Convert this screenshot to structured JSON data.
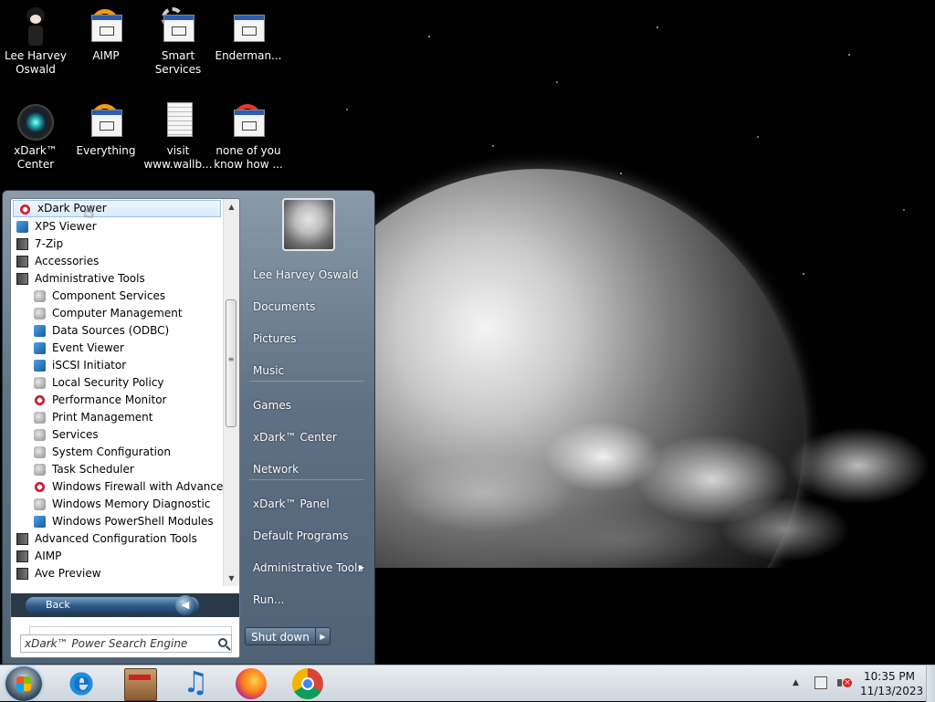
{
  "desktop_icons": [
    {
      "label": "Lee Harvey Oswald",
      "icon": "user-doll-icon"
    },
    {
      "label": "AIMP",
      "icon": "aimp-icon"
    },
    {
      "label": "Smart Services",
      "icon": "gear-icon"
    },
    {
      "label": "Enderman...",
      "icon": "app-window-icon"
    },
    {
      "label": "xDark™ Center",
      "icon": "xdark-orb-icon"
    },
    {
      "label": "Everything",
      "icon": "everything-icon"
    },
    {
      "label": "visit www.wallb...",
      "icon": "document-icon"
    },
    {
      "label": "none of you know how ...",
      "icon": "red-ring-icon"
    }
  ],
  "start_menu": {
    "programs": [
      {
        "label": "xDark Power",
        "level": 0,
        "icon": "xdark-power-icon",
        "highlighted": true
      },
      {
        "label": "XPS Viewer",
        "level": 0,
        "icon": "xps-viewer-icon"
      },
      {
        "label": "7-Zip",
        "level": 0,
        "icon": "folder-icon"
      },
      {
        "label": "Accessories",
        "level": 0,
        "icon": "folder-icon"
      },
      {
        "label": "Administrative Tools",
        "level": 0,
        "icon": "folder-icon"
      },
      {
        "label": "Component Services",
        "level": 1,
        "icon": "component-services-icon"
      },
      {
        "label": "Computer Management",
        "level": 1,
        "icon": "computer-management-icon"
      },
      {
        "label": "Data Sources (ODBC)",
        "level": 1,
        "icon": "database-icon"
      },
      {
        "label": "Event Viewer",
        "level": 1,
        "icon": "event-viewer-icon"
      },
      {
        "label": "iSCSI Initiator",
        "level": 1,
        "icon": "globe-icon"
      },
      {
        "label": "Local Security Policy",
        "level": 1,
        "icon": "security-policy-icon"
      },
      {
        "label": "Performance Monitor",
        "level": 1,
        "icon": "performance-monitor-icon"
      },
      {
        "label": "Print Management",
        "level": 1,
        "icon": "printer-icon"
      },
      {
        "label": "Services",
        "level": 1,
        "icon": "services-icon"
      },
      {
        "label": "System Configuration",
        "level": 1,
        "icon": "system-config-icon"
      },
      {
        "label": "Task Scheduler",
        "level": 1,
        "icon": "task-scheduler-icon"
      },
      {
        "label": "Windows Firewall with Advanced Se",
        "level": 1,
        "icon": "firewall-icon"
      },
      {
        "label": "Windows Memory Diagnostic",
        "level": 1,
        "icon": "memory-diagnostic-icon"
      },
      {
        "label": "Windows PowerShell Modules",
        "level": 1,
        "icon": "powershell-icon"
      },
      {
        "label": "Advanced Configuration Tools",
        "level": 0,
        "icon": "folder-icon"
      },
      {
        "label": "AIMP",
        "level": 0,
        "icon": "folder-icon"
      },
      {
        "label": "Ave Preview",
        "level": 0,
        "icon": "folder-icon"
      }
    ],
    "back_label": "Back",
    "search_placeholder": "xDark™ Power Search Engine",
    "right_items": [
      {
        "label": "Lee Harvey Oswald",
        "submenu": false
      },
      {
        "label": "Documents",
        "submenu": false
      },
      {
        "label": "Pictures",
        "submenu": false
      },
      {
        "label": "Music",
        "submenu": false
      },
      {
        "label": "Games",
        "submenu": false
      },
      {
        "label": "xDark™ Center",
        "submenu": false
      },
      {
        "label": "Network",
        "submenu": false
      },
      {
        "label": "xDark™ Panel",
        "submenu": false
      },
      {
        "label": "Default Programs",
        "submenu": false
      },
      {
        "label": "Administrative Tools",
        "submenu": true
      },
      {
        "label": "Run...",
        "submenu": false
      }
    ],
    "shutdown_label": "Shut down"
  },
  "taskbar": {
    "pinned": [
      {
        "name": "internet-explorer",
        "icon": "ie-icon"
      },
      {
        "name": "app-box",
        "icon": "box-icon"
      },
      {
        "name": "music-player",
        "icon": "music-note-icon"
      },
      {
        "name": "firefox",
        "icon": "firefox-icon"
      },
      {
        "name": "chrome",
        "icon": "chrome-icon"
      }
    ],
    "clock_time": "10:35 PM",
    "clock_date": "11/13/2023"
  },
  "colors": {
    "start_menu_gradient_top": "#8a9aa8",
    "highlight_border": "#9cc3ea",
    "taskbar_bg": "#dfe5eb"
  }
}
